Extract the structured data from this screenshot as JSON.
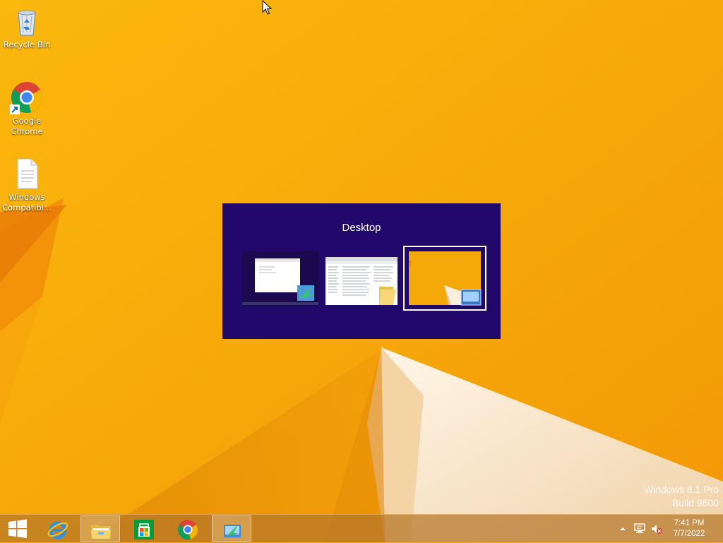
{
  "desktop_icons": [
    {
      "label": "Recycle Bin",
      "icon": "recycle-bin-icon"
    },
    {
      "label": "Google Chrome",
      "icon": "chrome-icon"
    },
    {
      "label": "Windows Compatibi...",
      "icon": "document-icon"
    }
  ],
  "switcher": {
    "title": "Desktop",
    "thumbnails": [
      {
        "name": "installer-window",
        "selected": false
      },
      {
        "name": "file-explorer-window",
        "selected": false
      },
      {
        "name": "desktop",
        "selected": true
      }
    ]
  },
  "taskbar": {
    "buttons": [
      {
        "name": "start",
        "icon": "windows-logo-icon",
        "open": false
      },
      {
        "name": "internet-explorer",
        "icon": "ie-icon",
        "open": false
      },
      {
        "name": "file-explorer",
        "icon": "folder-icon",
        "open": true
      },
      {
        "name": "store",
        "icon": "store-icon",
        "open": false
      },
      {
        "name": "chrome",
        "icon": "chrome-icon",
        "open": false
      },
      {
        "name": "installer",
        "icon": "installer-icon",
        "open": true
      }
    ]
  },
  "tray": {
    "time": "7:41 PM",
    "date": "7/7/2022",
    "icons": [
      "show-hidden-icons-icon",
      "network-icon",
      "volume-muted-icon"
    ]
  },
  "watermark": {
    "line1": "Windows 8.1 Pro",
    "line2": "Build 9600"
  },
  "colors": {
    "wallpaper": "#f7a90a",
    "switcher_bg": "#21086b",
    "taskbar": "#b6762a"
  }
}
